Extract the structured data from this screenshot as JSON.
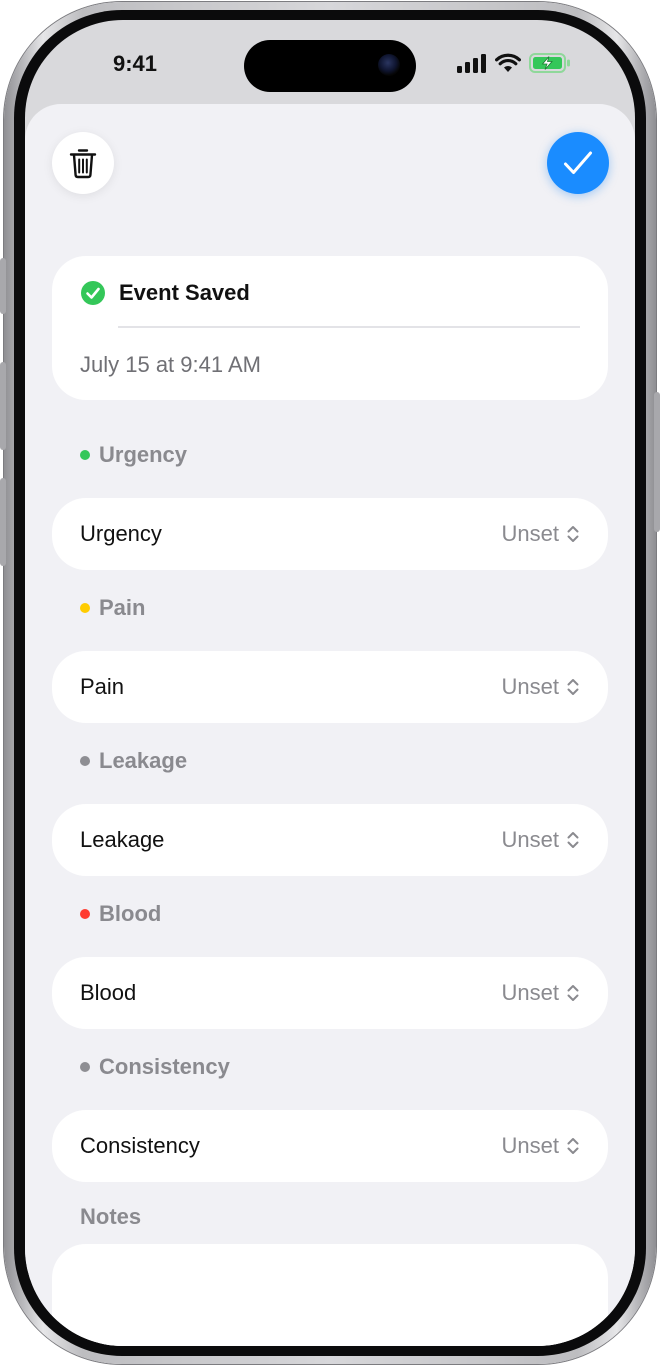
{
  "status_bar": {
    "time": "9:41",
    "icons": [
      "cellular-signal-icon",
      "wifi-icon",
      "battery-charging-icon"
    ]
  },
  "toolbar": {
    "delete_icon": "trash-icon",
    "done_icon": "checkmark-icon"
  },
  "event": {
    "status": "Event Saved",
    "timestamp": "July 15 at 9:41 AM"
  },
  "fields": [
    {
      "section": "Urgency",
      "label": "Urgency",
      "value": "Unset",
      "color": "#34c759"
    },
    {
      "section": "Pain",
      "label": "Pain",
      "value": "Unset",
      "color": "#ffcc00"
    },
    {
      "section": "Leakage",
      "label": "Leakage",
      "value": "Unset",
      "color": "#8e8e93"
    },
    {
      "section": "Blood",
      "label": "Blood",
      "value": "Unset",
      "color": "#ff3b30"
    },
    {
      "section": "Consistency",
      "label": "Consistency",
      "value": "Unset",
      "color": "#8e8e93"
    }
  ],
  "notes": {
    "label": "Notes",
    "value": ""
  },
  "colors": {
    "accent": "#1a8cff",
    "success": "#34c759"
  }
}
